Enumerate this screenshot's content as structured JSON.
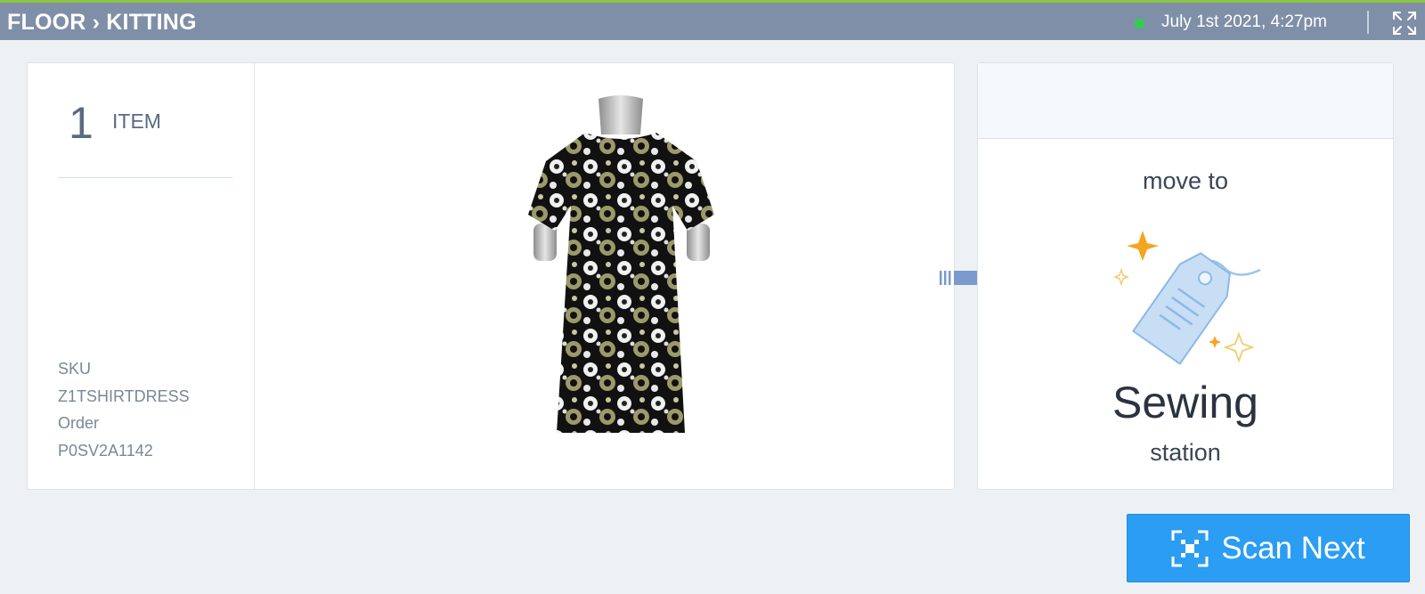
{
  "header": {
    "breadcrumb": "FLOOR › KITTING",
    "datetime": "July 1st 2021, 4:27pm",
    "status_color": "#2ed04b",
    "accent_bar_color": "#8cc63e",
    "expand_icon": "expand-icon"
  },
  "item": {
    "count": "1",
    "count_label": "ITEM",
    "sku_label": "SKU",
    "sku_value": "Z1TSHIRTDRESS",
    "order_label": "Order",
    "order_value": "P0SV2A1142",
    "image": "floral-dress-image"
  },
  "destination": {
    "move_to": "move to",
    "name": "Sewing",
    "subtitle": "station",
    "icon": "tag-icon"
  },
  "actions": {
    "scan_label": "Scan Next",
    "scan_icon": "scan-icon",
    "button_color": "#2b9df3"
  }
}
